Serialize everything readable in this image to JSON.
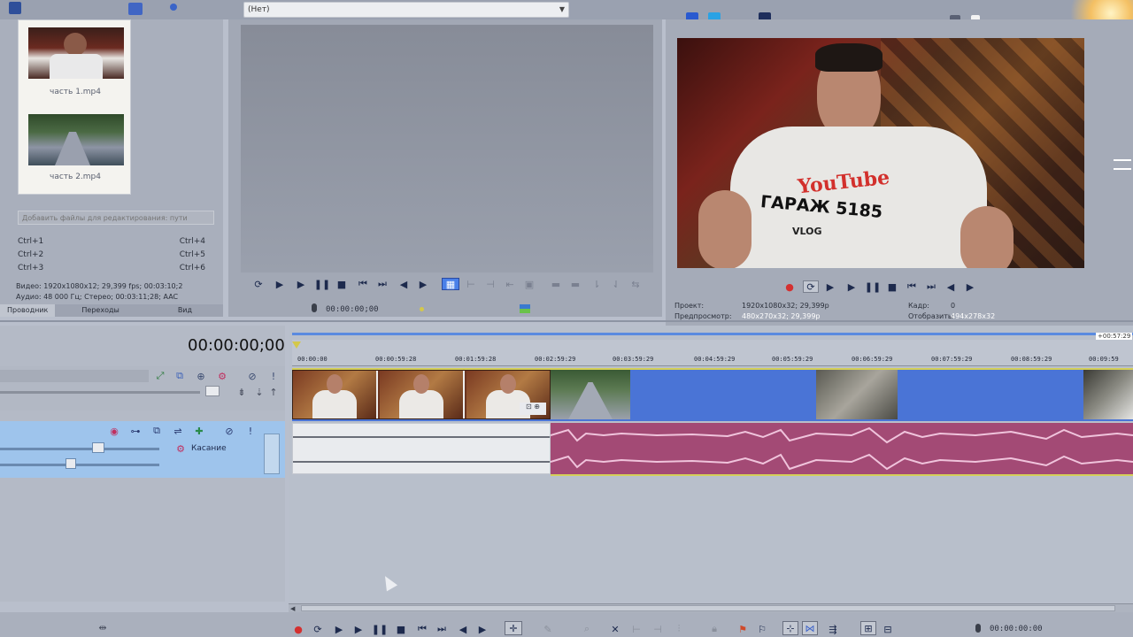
{
  "colors": {
    "bg": "#b9bfcc",
    "panel": "#a9afbc",
    "track_selected": "#9ec4ec",
    "video_gap": "#4a74d6",
    "audio_clip": "#a34a75",
    "audio_light": "#e9ebee",
    "timeline_cursor": "#3a62c8"
  },
  "media": {
    "items": [
      {
        "name": "часть 1.mp4"
      },
      {
        "name": "часть 2.mp4"
      }
    ],
    "search_placeholder": "Добавить файлы для редактирования: пути",
    "shortcuts": [
      {
        "left": "Ctrl+1",
        "right": "Ctrl+4"
      },
      {
        "left": "Ctrl+2",
        "right": "Ctrl+5"
      },
      {
        "left": "Ctrl+3",
        "right": "Ctrl+6"
      }
    ],
    "info_video": "Видео: 1920x1080x12; 29,399 fps; 00:03:10;2",
    "info_audio": "Аудио: 48 000 Гц; Стерео; 00:03:11;28; AAC",
    "tabs": [
      "Проводник",
      "Переходы",
      "Вид"
    ]
  },
  "trimmer": {
    "dropdown_value": "(Нет)",
    "timecode": "00:00:00;00"
  },
  "preview": {
    "project_label": "Проект:",
    "project_value": "1920x1080x32; 29,399p",
    "preview_label": "Предпросмотр:",
    "preview_value": "480x270x32; 29,399p",
    "frame_label": "Кадр:",
    "frame_value": "0",
    "display_label": "Отобразить:",
    "display_value": "494x278x32",
    "shirt_text1": "YouTube",
    "shirt_text2": "ГАРАЖ 5185",
    "shirt_text3": "VLOG"
  },
  "timeline": {
    "main_timecode": "00:00:00;00",
    "end_marker": "+00:57:29",
    "ticks": [
      "00:00:00",
      "00:00:59:28",
      "00:01:59:28",
      "00:02:59:29",
      "00:03:59:29",
      "00:04:59:29",
      "00:05:59:29",
      "00:06:59:29",
      "00:07:59:29",
      "00:08:59:29",
      "00:09:59"
    ],
    "audio_track_label": "Касание",
    "transport_timecode": "00:00:00:00"
  }
}
